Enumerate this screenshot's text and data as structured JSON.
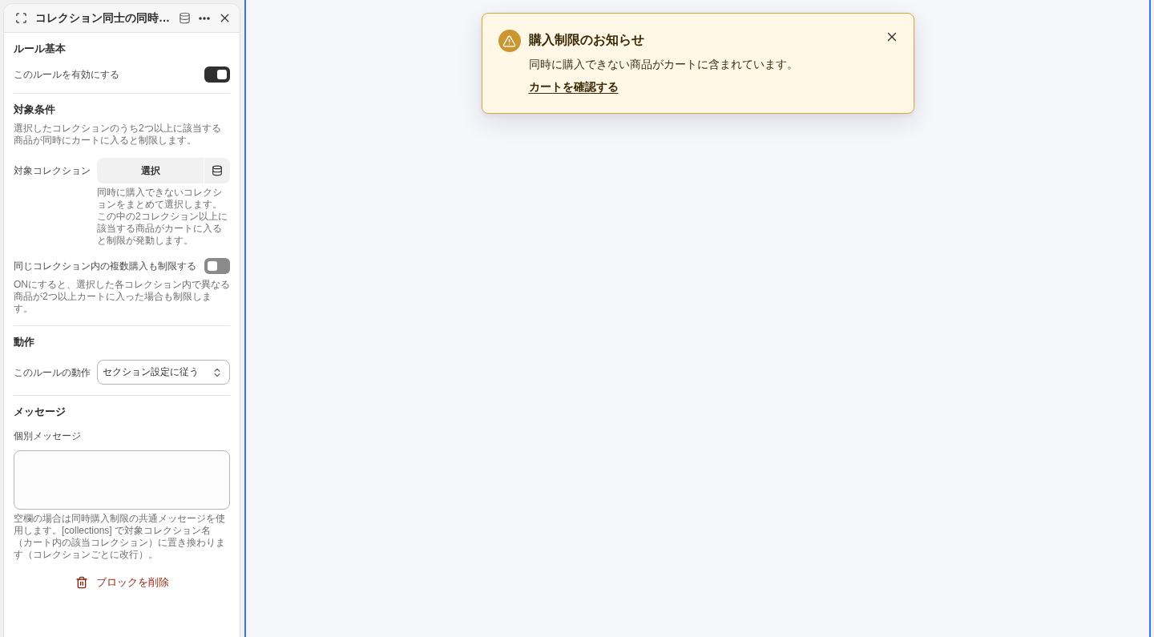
{
  "panel": {
    "title": "コレクション同士の同時…",
    "sections": [
      {
        "heading": "ルール基本",
        "fields": [
          {
            "kind": "toggle",
            "label": "このルールを有効にする",
            "on": true
          }
        ]
      },
      {
        "heading": "対象条件",
        "description": "選択したコレクションのうち2つ以上に該当する商品が同時にカートに入ると制限します。",
        "fields": [
          {
            "kind": "picker",
            "label": "対象コレクション",
            "button": "選択",
            "help": "同時に購入できないコレクションをまとめて選択します。この中の2コレクション以上に該当する商品がカートに入ると制限が発動します。"
          },
          {
            "kind": "toggle",
            "label": "同じコレクション内の複数購入も制限する",
            "on": false,
            "help": "ONにすると、選択した各コレクション内で異なる商品が2つ以上カートに入った場合も制限します。"
          }
        ]
      },
      {
        "heading": "動作",
        "fields": [
          {
            "kind": "select",
            "label": "このルールの動作",
            "value": "セクション設定に従う"
          }
        ]
      },
      {
        "heading": "メッセージ",
        "fields": [
          {
            "kind": "textarea",
            "label": "個別メッセージ",
            "help": "空欄の場合は同時購入制限の共通メッセージを使用します。[collections] で対象コレクション名（カート内の該当コレクション）に置き換わります（コレクションごとに改行）。"
          }
        ]
      }
    ],
    "delete_button": "ブロックを削除"
  },
  "toast": {
    "title": "購入制限のお知らせ",
    "message": "同時に購入できない商品がカートに含まれています。",
    "link": "カートを確認する"
  }
}
